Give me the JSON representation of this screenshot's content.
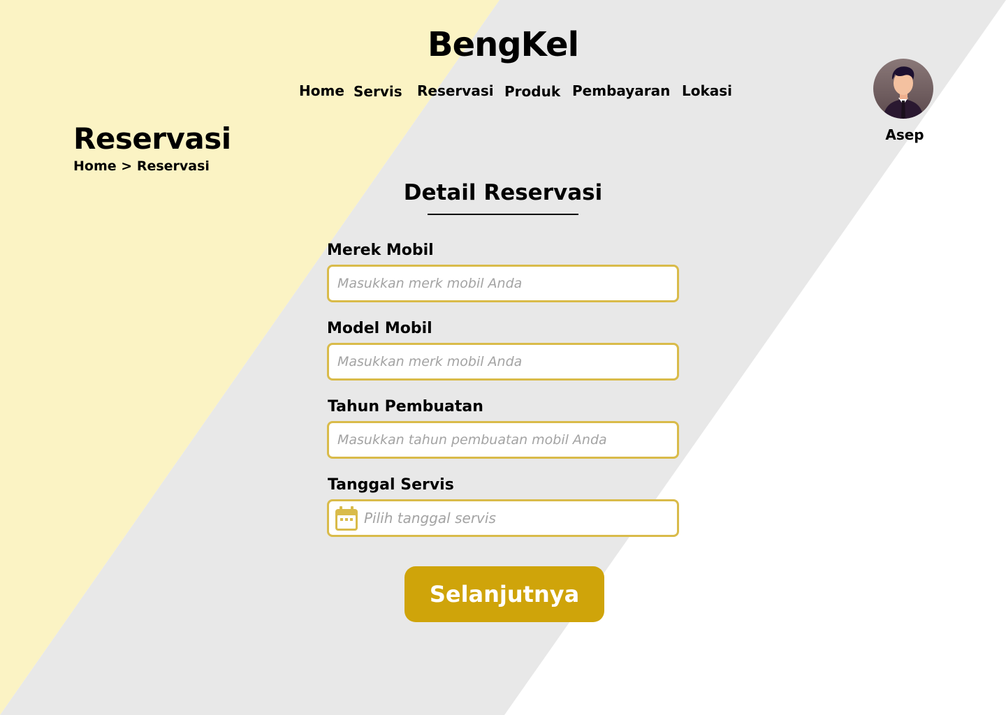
{
  "brand": "BengKel",
  "nav": {
    "items": [
      "Home",
      "Servis",
      "Reservasi",
      "Produk",
      "Pembayaran",
      "Lokasi"
    ]
  },
  "user": {
    "name": "Asep"
  },
  "page": {
    "title": "Reservasi",
    "breadcrumb": {
      "home": "Home",
      "separator": ">",
      "current": "Reservasi"
    }
  },
  "form": {
    "title": "Detail Reservasi",
    "fields": [
      {
        "label": "Merek Mobil",
        "placeholder": "Masukkan merk mobil Anda",
        "value": ""
      },
      {
        "label": "Model Mobil",
        "placeholder": "Masukkan merk mobil Anda",
        "value": ""
      },
      {
        "label": "Tahun Pembuatan",
        "placeholder": "Masukkan tahun pembuatan mobil Anda",
        "value": ""
      },
      {
        "label": "Tanggal Servis",
        "placeholder": "Pilih tanggal servis",
        "value": "",
        "icon": "calendar-icon"
      }
    ],
    "submit_label": "Selanjutnya"
  },
  "colors": {
    "accent": "#cfa40a",
    "field_border": "#d9bb4a",
    "background_yellow": "#fbf3c4",
    "background_gray": "#e8e8e8"
  }
}
